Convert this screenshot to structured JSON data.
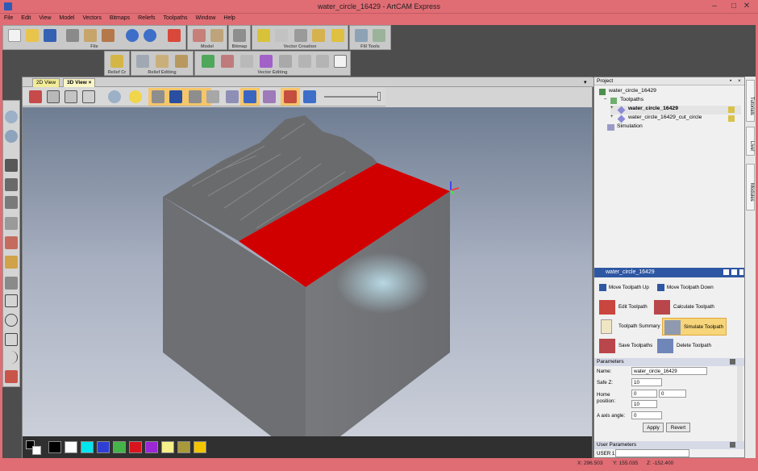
{
  "window": {
    "title": "water_circle_16429 - ArtCAM Express"
  },
  "menu": [
    "File",
    "Edit",
    "View",
    "Model",
    "Vectors",
    "Bitmaps",
    "Reliefs",
    "Toolpaths",
    "Window",
    "Help"
  ],
  "toolbar_groups": {
    "file": "File",
    "model": "Model",
    "bitmap": "Bitmap",
    "vector_creation": "Vector Creation",
    "fill_tools": "Fill Tools",
    "relief_cr": "Relief Cr",
    "relief_editing": "Relief Editing",
    "vector_editing": "Vector Editing"
  },
  "view_tabs": [
    "2D View",
    "3D View"
  ],
  "palette_colors": [
    "#000000",
    "#ffffff",
    "#00e5ee",
    "#2f3fd6",
    "#44b44a",
    "#d9141c",
    "#9b27d6",
    "#f6f08a",
    "#a89a3a",
    "#f3c500"
  ],
  "project": {
    "header": "Project",
    "root": "water_circle_16429",
    "toolpaths": "Toolpaths",
    "items": [
      "water_circle_16429",
      "water_circle_16429_cut_circle"
    ],
    "simulation": "Simulation"
  },
  "toolpath_panel": {
    "title": "water_circle_16429",
    "move_up": "Move Toolpath Up",
    "move_down": "Move Toolpath Down",
    "edit": "Edit Toolpath",
    "calculate": "Calculate Toolpath",
    "summary": "Toolpath Summary",
    "simulate": "Simulate Toolpath",
    "save": "Save Toolpaths",
    "delete": "Delete Toolpath"
  },
  "parameters": {
    "header": "Parameters",
    "name_label": "Name:",
    "name_value": "water_circle_16429",
    "safe_z_label": "Safe Z:",
    "safe_z_value": "10",
    "home_label_1": "Home",
    "home_label_2": "position:",
    "home_x": "0",
    "home_y": "0",
    "home_z": "10",
    "a_axis_label": "A axis angle:",
    "a_axis_value": "0",
    "apply": "Apply",
    "revert": "Revert"
  },
  "user_parameters": {
    "header": "User Parameters",
    "user1_label": "USER 1:"
  },
  "side_tabs": [
    "Tutorials",
    "Live!",
    "Modules"
  ],
  "status": {
    "x": "X: 296.503",
    "y": "Y: 155.035",
    "z": "Z: -152.400"
  }
}
